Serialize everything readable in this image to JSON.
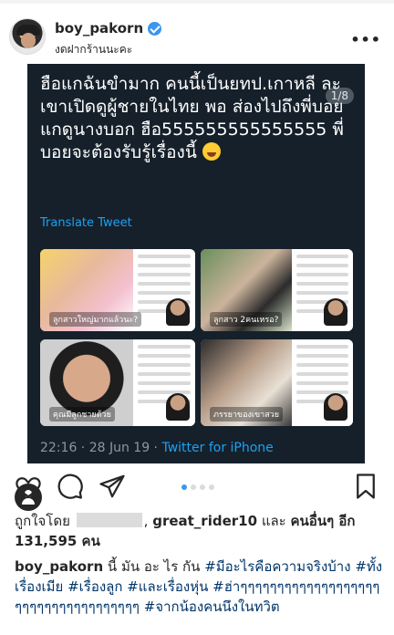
{
  "header": {
    "username": "boy_pakorn",
    "location": "งดฝากร้านนะคะ",
    "more": "•••"
  },
  "post": {
    "page_counter": "1/8",
    "tweet": {
      "text": "ฮือแกฉันขำมาก คนนี้เป็นยทป.เกาหลี ละเขาเปิดดูผู้ชายในไทย พอ ส่องไปถึงพี่บอย แกดูนางบอก ฮือ555555555555555 พี่บอยจะต้องรับรู้เรื่องนี้",
      "translate": "Translate Tweet",
      "time": "22:16 · 28 Jun 19 · ",
      "via": "Twitter for iPhone",
      "thumb_captions": [
        "ลูกสาวใหญ่มากแล้วนะ?",
        "ลูกสาว 2คนเหรอ?",
        "คุณมีลูกชายด้วย",
        "ภรรยาของเขาสวย"
      ]
    }
  },
  "actions": {
    "carousel_count": 4,
    "carousel_active": 0
  },
  "likes": {
    "prefix": "ถูกใจโดย",
    "user": "great_rider10",
    "and": "และ",
    "others": "คนอื่นๆ อีก 131,595 คน"
  },
  "caption": {
    "username": "boy_pakorn",
    "text": "นี้ มัน อะ ไร กัน",
    "tags": "#มีอะไรคือความจริงบ้าง #ทั้งเรื่องเมีย #เรื่องลูก #และเรื่องหุ่น #ฮ่าๆๆๆๆๆๆๆๆๆๆๆๆๆๆๆๆๆๆๆๆๆๆๆๆๆๆๆๆๆๆๆๆๆๆๆๆ #จากน้องคนนึงในทวิต"
  },
  "colors": {
    "tweet_bg": "#15202b",
    "link": "#1da1f2",
    "verified": "#3897f0",
    "hashtag": "#003569"
  }
}
